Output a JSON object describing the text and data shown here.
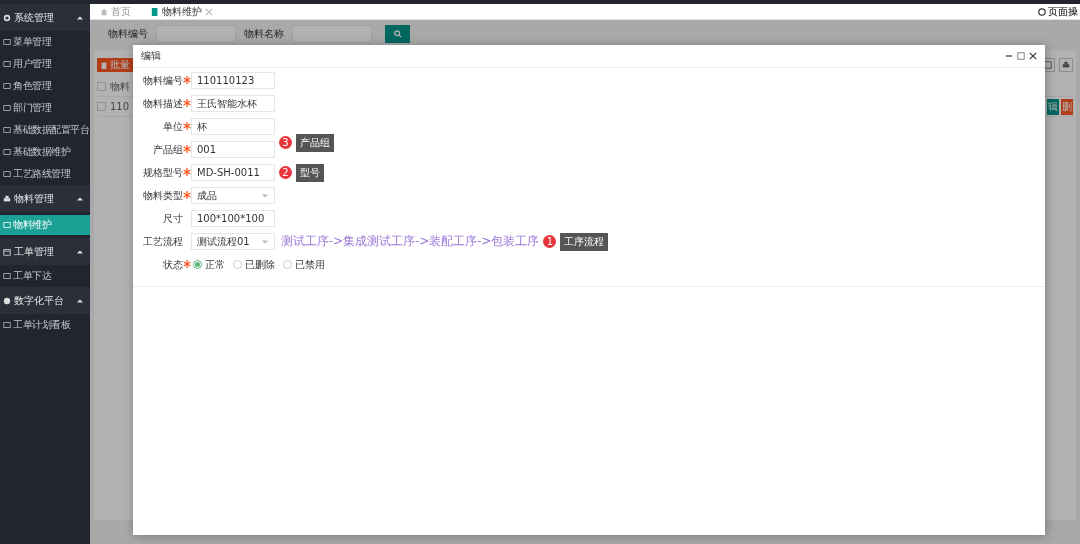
{
  "sidebar": {
    "groups": [
      {
        "label": "系统管理",
        "expanded": true,
        "items": [
          {
            "label": "菜单管理",
            "selected": false
          },
          {
            "label": "用户管理",
            "selected": false
          },
          {
            "label": "角色管理",
            "selected": false
          },
          {
            "label": "部门管理",
            "selected": false
          },
          {
            "label": "基础数据配置平台",
            "selected": false
          },
          {
            "label": "基础数据维护",
            "selected": false
          },
          {
            "label": "工艺路线管理",
            "selected": false
          }
        ]
      },
      {
        "label": "物料管理",
        "expanded": true,
        "items": [
          {
            "label": "物料维护",
            "selected": true
          }
        ]
      },
      {
        "label": "工单管理",
        "expanded": true,
        "items": [
          {
            "label": "工单下达",
            "selected": false
          }
        ]
      },
      {
        "label": "数字化平台",
        "expanded": true,
        "items": [
          {
            "label": "工单计划看板",
            "selected": false
          }
        ]
      }
    ]
  },
  "tabs": [
    {
      "label": "首页",
      "selected": false
    },
    {
      "label": "物料维护",
      "selected": true
    }
  ],
  "page_actions": {
    "label": "页面操"
  },
  "search": {
    "fields": [
      {
        "label": "物料编号"
      },
      {
        "label": "物料名称"
      }
    ]
  },
  "toolbar": {
    "batch_delete": "批量"
  },
  "table": {
    "header_checked": false,
    "column_1": "物料",
    "rows": [
      {
        "checked": false,
        "cell_1": "110",
        "actions": [
          "辑",
          "删"
        ]
      }
    ]
  },
  "dialog": {
    "title": "编辑",
    "fields": [
      {
        "kind": "text",
        "label": "物料编号",
        "required": true,
        "value": "110110123"
      },
      {
        "kind": "text",
        "label": "物料描述",
        "required": true,
        "value": "王氏智能水杯"
      },
      {
        "kind": "text",
        "label": "单位",
        "required": true,
        "value": "杯"
      },
      {
        "kind": "text",
        "label": "产品组",
        "required": true,
        "value": "001",
        "annotation": {
          "badge": "3",
          "note": "产品组"
        }
      },
      {
        "kind": "text",
        "label": "规格型号",
        "required": true,
        "value": "MD-SH-0011",
        "annotation": {
          "badge": "2",
          "note": "型号"
        }
      },
      {
        "kind": "select",
        "label": "物料类型",
        "required": true,
        "value": "成品"
      },
      {
        "kind": "text",
        "label": "尺寸",
        "required": false,
        "value": "100*100*100"
      },
      {
        "kind": "select",
        "label": "工艺流程",
        "required": false,
        "value": "测试流程01",
        "flow": "测试工序->集成测试工序->装配工序->包装工序",
        "annotation": {
          "badge": "1",
          "note": "工序流程"
        }
      },
      {
        "kind": "radio",
        "label": "状态",
        "required": true,
        "options": [
          {
            "label": "正常",
            "selected": true
          },
          {
            "label": "已删除",
            "selected": false
          },
          {
            "label": "已禁用",
            "selected": false
          }
        ]
      }
    ]
  }
}
